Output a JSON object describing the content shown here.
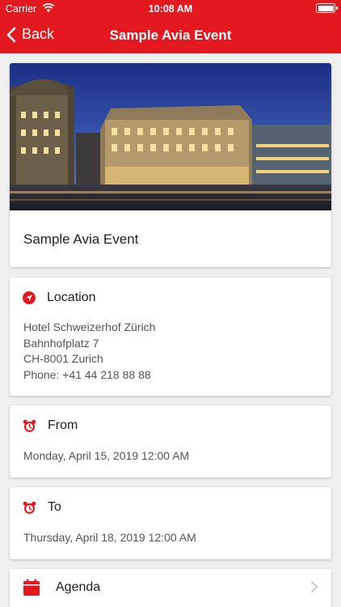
{
  "status_bar": {
    "carrier": "Carrier",
    "time": "10:08 AM",
    "battery_percent": 100
  },
  "nav": {
    "back_label": "Back",
    "title": "Sample Avia Event"
  },
  "event": {
    "name": "Sample Avia Event"
  },
  "location": {
    "heading": "Location",
    "lines": [
      "Hotel Schweizerhof Zürich",
      "Bahnhofplatz 7",
      "CH-8001 Zurich",
      "Phone: +41 44 218 88 88"
    ]
  },
  "from": {
    "heading": "From",
    "value": "Monday, April 15, 2019 12:00 AM"
  },
  "to": {
    "heading": "To",
    "value": "Thursday, April 18, 2019 12:00 AM"
  },
  "agenda": {
    "label": "Agenda"
  },
  "colors": {
    "brand": "#e3191f",
    "background": "#efefef"
  },
  "icons": [
    "wifi-icon",
    "battery-icon",
    "back-chevron-icon",
    "location-arrow-icon",
    "alarm-clock-icon",
    "calendar-icon",
    "chevron-right-icon"
  ]
}
